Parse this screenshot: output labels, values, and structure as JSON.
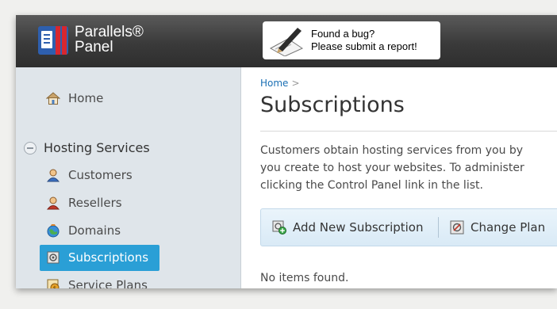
{
  "header": {
    "logo_line1": "Parallels®",
    "logo_line2": "Panel",
    "bug_line1": "Found a bug?",
    "bug_line2": "Please submit a report!"
  },
  "sidebar": {
    "home_label": "Home",
    "group_label": "Hosting Services",
    "items": [
      {
        "label": "Customers",
        "icon": "customer-icon"
      },
      {
        "label": "Resellers",
        "icon": "reseller-icon"
      },
      {
        "label": "Domains",
        "icon": "globe-icon"
      },
      {
        "label": "Subscriptions",
        "icon": "subscription-icon",
        "selected": true
      },
      {
        "label": "Service Plans",
        "icon": "service-plan-icon"
      }
    ]
  },
  "main": {
    "breadcrumb_home": "Home",
    "breadcrumb_sep": ">",
    "title": "Subscriptions",
    "description": [
      "Customers obtain hosting services from you by",
      "you create to host your websites. To administer",
      "clicking the Control Panel link in the list."
    ],
    "toolbar": {
      "add_label": "Add New Subscription",
      "change_label": "Change Plan"
    },
    "empty_message": "No items found."
  },
  "colors": {
    "header_bg": "#3a3a3a",
    "sidebar_bg": "#dfe5ea",
    "selected_bg": "#2a9fd6",
    "link": "#1a6fb4",
    "toolbar_bg": "#d9eaf6"
  }
}
